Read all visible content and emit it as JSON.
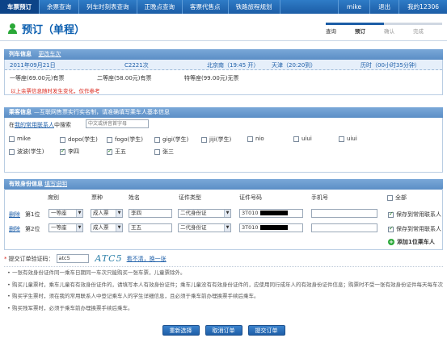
{
  "topnav": {
    "items": [
      "车票预订",
      "余票查询",
      "列车时刻表查询",
      "正晚点查询",
      "客票代售点",
      "铁路旅程规划"
    ],
    "user": "mike",
    "logout": "退出",
    "my": "我的12306"
  },
  "page": {
    "title": "预订（单程）"
  },
  "steps": [
    "查询",
    "预订",
    "确认",
    "完成"
  ],
  "train_info": {
    "section": "列车信息",
    "change_link": "更改车次",
    "date": "2011年09月21日",
    "train_no": "C2221次",
    "from": "北京南（19:45 开）",
    "to": "天津（20:20到）",
    "duration": "历时（00小时35分钟）",
    "seats": [
      "一等座(69.00元)有票",
      "二等座(58.00元)有票",
      "特等座(99.00元)无票"
    ],
    "warning": "以上余票信息随时发生变化，仅作参考"
  },
  "passenger_info": {
    "section": "乘客信息",
    "sub": "—互联网售票实行实名制，请准确填写乘车人基本信息",
    "search_prefix": "在",
    "search_link": "我的常用联系人",
    "search_suffix": "中搜索",
    "search_placeholder": "中文或拼音首字母",
    "contacts": [
      {
        "name": "mike",
        "checked": false
      },
      {
        "name": "dopo(学生)",
        "checked": false
      },
      {
        "name": "fogo(学生)",
        "checked": false
      },
      {
        "name": "gigi(学生)",
        "checked": false
      },
      {
        "name": "jiji(学生)",
        "checked": false
      },
      {
        "name": "nio",
        "checked": false
      },
      {
        "name": "uiui",
        "checked": false
      },
      {
        "name": "uiui",
        "checked": false
      },
      {
        "name": "波波(学生)",
        "checked": false
      },
      {
        "name": "李四",
        "checked": true
      },
      {
        "name": "王五",
        "checked": true
      },
      {
        "name": "张三",
        "checked": false
      }
    ]
  },
  "id_info": {
    "section": "有效身份信息",
    "help_link": "填写说明",
    "headers": [
      "席别",
      "票种",
      "姓名",
      "证件类型",
      "证件号码",
      "手机号",
      "全部"
    ],
    "rows": [
      {
        "delete": "删除",
        "no": "第1位",
        "seat": "一等座",
        "ticket": "成人票",
        "name": "李四",
        "id_type": "二代身份证",
        "id_no": "3T010",
        "save": "保存到常用联系人"
      },
      {
        "delete": "删除",
        "no": "第2位",
        "seat": "一等座",
        "ticket": "成人票",
        "name": "王五",
        "id_type": "二代身份证",
        "id_no": "3T010",
        "save": "保存到常用联系人"
      }
    ],
    "add": "添加1位乘车人"
  },
  "captcha": {
    "label": "提交订单验证码：",
    "value": "atc5",
    "image_text": "ATC5",
    "refresh": "看不清，换一张"
  },
  "notes": [
    "一张有效身份证件同一乘车日期同一车次只能购买一张车票，儿童票除外。",
    "购买儿童票时，乘车儿童有有效身份证件的，请填写本人有效身份证件；乘车儿童没有有效身份证件的，应使用同行成年人的有效身份证件信息；购票时不受一张有效身份证件每天每车次只能购买一张车票的限制。",
    "购买学生票时，须在我的常用联系人中登记乘车人的学生详细信息，且必须于乘车前办理换票手续后乘车。",
    "购买残军票时，必须于乘车前办理换票手续后乘车。"
  ],
  "buttons": [
    "重新选择",
    "取消订单",
    "提交订单"
  ]
}
